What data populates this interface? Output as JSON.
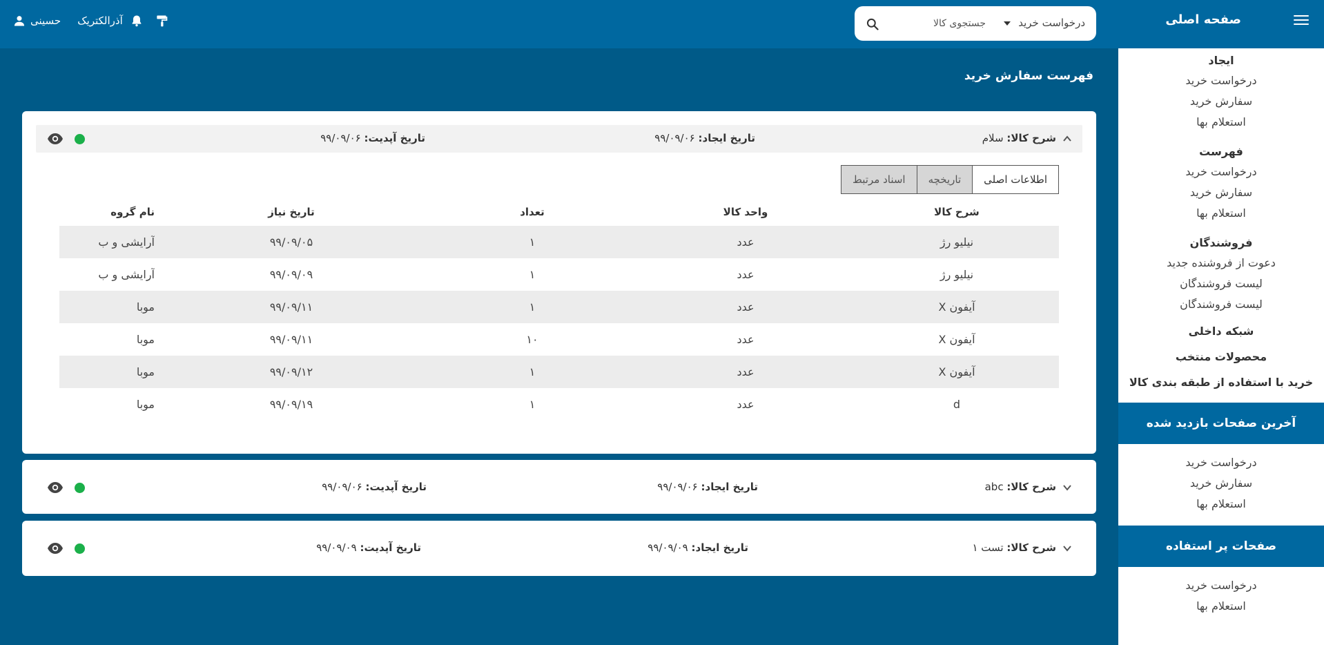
{
  "header": {
    "home_title": "صفحه اصلی",
    "search": {
      "category": "درخواست خرید",
      "placeholder": "جستجوی کالا"
    },
    "company": "آذرالکتریک",
    "user": "حسینی",
    "icons": [
      "menu-icon",
      "search-icon",
      "paint-roller-icon",
      "bell-icon",
      "user-icon"
    ]
  },
  "sidebar": {
    "create": {
      "title": "ایجاد",
      "items": [
        "درخواست خرید",
        "سفارش خرید",
        "استعلام بها"
      ]
    },
    "list": {
      "title": "فهرست",
      "items": [
        "درخواست خرید",
        "سفارش خرید",
        "استعلام بها"
      ]
    },
    "vendors": {
      "title": "فروشندگان",
      "items": [
        "دعوت از فروشنده جدید",
        "لیست فروشندگان",
        "لیست فروشندگان"
      ]
    },
    "intranet": "شبکه داخلی",
    "featured": "محصولات منتخب",
    "category_buy": "خرید با استفاده از طبقه بندی کالا",
    "recent": {
      "title": "آخرین صفحات بازدید شده",
      "items": [
        "درخواست خرید",
        "سفارش خرید",
        "استعلام بها"
      ]
    },
    "popular": {
      "title": "صفحات پر استفاده",
      "items": [
        "درخواست خرید",
        "استعلام بها"
      ]
    }
  },
  "main": {
    "title": "فهرست سفارش خرید",
    "labels": {
      "desc": "شرح کالا:",
      "created": "تاریخ ایجاد:",
      "updated": "تاریخ آپدیت:"
    },
    "orders": [
      {
        "desc": "سلام",
        "created": "۹۹/۰۹/۰۶",
        "updated": "۹۹/۰۹/۰۶",
        "expanded": true
      },
      {
        "desc": "abc",
        "created": "۹۹/۰۹/۰۶",
        "updated": "۹۹/۰۹/۰۶",
        "expanded": false
      },
      {
        "desc": "تست ۱",
        "created": "۹۹/۰۹/۰۹",
        "updated": "۹۹/۰۹/۰۹",
        "expanded": false
      }
    ],
    "status_color": "#1bb04a",
    "tabs": [
      "اطلاعات اصلی",
      "تاریخچه",
      "اسناد مرتبط"
    ],
    "table": {
      "columns": [
        "شرح کالا",
        "واحد کالا",
        "تعداد",
        "تاریخ نیاز",
        "نام گروه"
      ],
      "rows": [
        [
          "نیلیو رژ",
          "عدد",
          "۱",
          "۹۹/۰۹/۰۵",
          "آرایشی و ب"
        ],
        [
          "نیلیو رژ",
          "عدد",
          "۱",
          "۹۹/۰۹/۰۹",
          "آرایشی و ب"
        ],
        [
          "آیفون X",
          "عدد",
          "۱",
          "۹۹/۰۹/۱۱",
          "موبا"
        ],
        [
          "آیفون X",
          "عدد",
          "۱۰",
          "۹۹/۰۹/۱۱",
          "موبا"
        ],
        [
          "آیفون X",
          "عدد",
          "۱",
          "۹۹/۰۹/۱۲",
          "موبا"
        ],
        [
          "d",
          "عدد",
          "۱",
          "۹۹/۰۹/۱۹",
          "موبا"
        ]
      ]
    }
  }
}
